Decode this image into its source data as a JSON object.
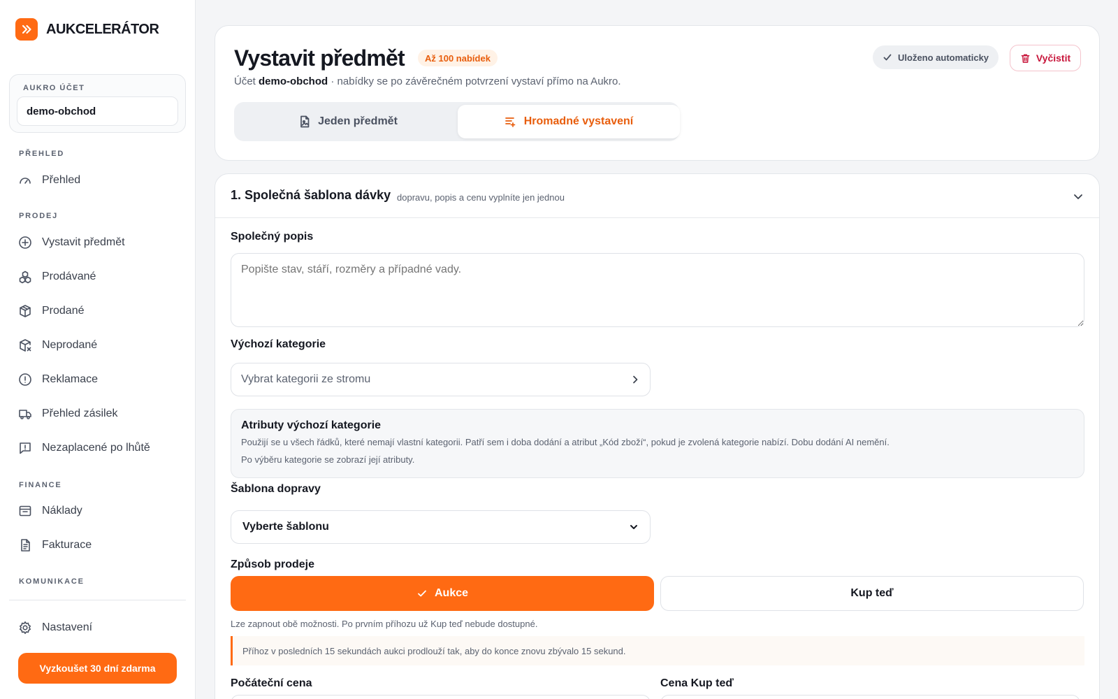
{
  "brand": {
    "name": "AUKCELERÁTOR",
    "accent": "#ff6a13"
  },
  "account": {
    "label": "AUKRO ÚČET",
    "value": "demo-obchod"
  },
  "nav": {
    "sections": {
      "overview": "PŘEHLED",
      "sell": "PRODEJ",
      "finance": "FINANCE",
      "communication": "KOMUNIKACE"
    },
    "items": [
      {
        "label": "Přehled",
        "icon": "gauge-icon"
      },
      {
        "label": "Vystavit předmět",
        "icon": "plus-circle-icon"
      },
      {
        "label": "Prodávané",
        "icon": "boxes-icon"
      },
      {
        "label": "Prodané",
        "icon": "package-icon"
      },
      {
        "label": "Neprodané",
        "icon": "package-x-icon"
      },
      {
        "label": "Reklamace",
        "icon": "alert-circle-icon"
      },
      {
        "label": "Přehled zásilek",
        "icon": "truck-icon"
      },
      {
        "label": "Nezaplacené po lhůtě",
        "icon": "message-alert-icon"
      },
      {
        "label": "Náklady",
        "icon": "wallet-icon"
      },
      {
        "label": "Fakturace",
        "icon": "invoice-icon"
      },
      {
        "label": "Nastavení",
        "icon": "gear-icon"
      }
    ],
    "trial_button": "Vyzkoušet 30 dní zdarma"
  },
  "header": {
    "title": "Vystavit předmět",
    "limit_badge": "Až 100 nabídek",
    "subtitle_prefix": "Účet",
    "subtitle_account": "demo-obchod",
    "subtitle_suffix": "· nabídky se po závěrečném potvrzení vystaví přímo na Aukro.",
    "saved_status": "Uloženo automaticky",
    "clear_button": "Vyčistit",
    "tabs": [
      {
        "label": "Jeden předmět",
        "active": false
      },
      {
        "label": "Hromadné vystavení",
        "active": true
      }
    ]
  },
  "template": {
    "title": "1. Společná šablona dávky",
    "hint": "dopravu, popis a cenu vyplníte jen jednou",
    "description_label": "Společný popis",
    "description_placeholder": "Popište stav, stáří, rozměry a případné vady.",
    "category_label": "Výchozí kategorie",
    "category_placeholder": "Vybrat kategorii ze stromu",
    "attributes_title": "Atributy výchozí kategorie",
    "attributes_text": "Použijí se u všech řádků, které nemají vlastní kategorii. Patří sem i doba dodání a atribut „Kód zboží“, pokud je zvolená kategorie nabízí. Dobu dodání AI nemění.",
    "attributes_note": "Po výběru kategorie se zobrazí její atributy.",
    "shipping_label": "Šablona dopravy",
    "shipping_value": "Vyberte šablonu",
    "sale_label": "Způsob prodeje",
    "sale_auction": "Aukce",
    "sale_buynow": "Kup teď",
    "sale_hint": "Lze zapnout obě možnosti. Po prvním příhozu už Kup teď nebude dostupné.",
    "info_note": "Příhoz v posledních 15 sekundách aukci prodlouží tak, aby do konce znovu zbývalo 15 sekund.",
    "start_price_label": "Počáteční cena",
    "buynow_price_label": "Cena Kup teď"
  }
}
